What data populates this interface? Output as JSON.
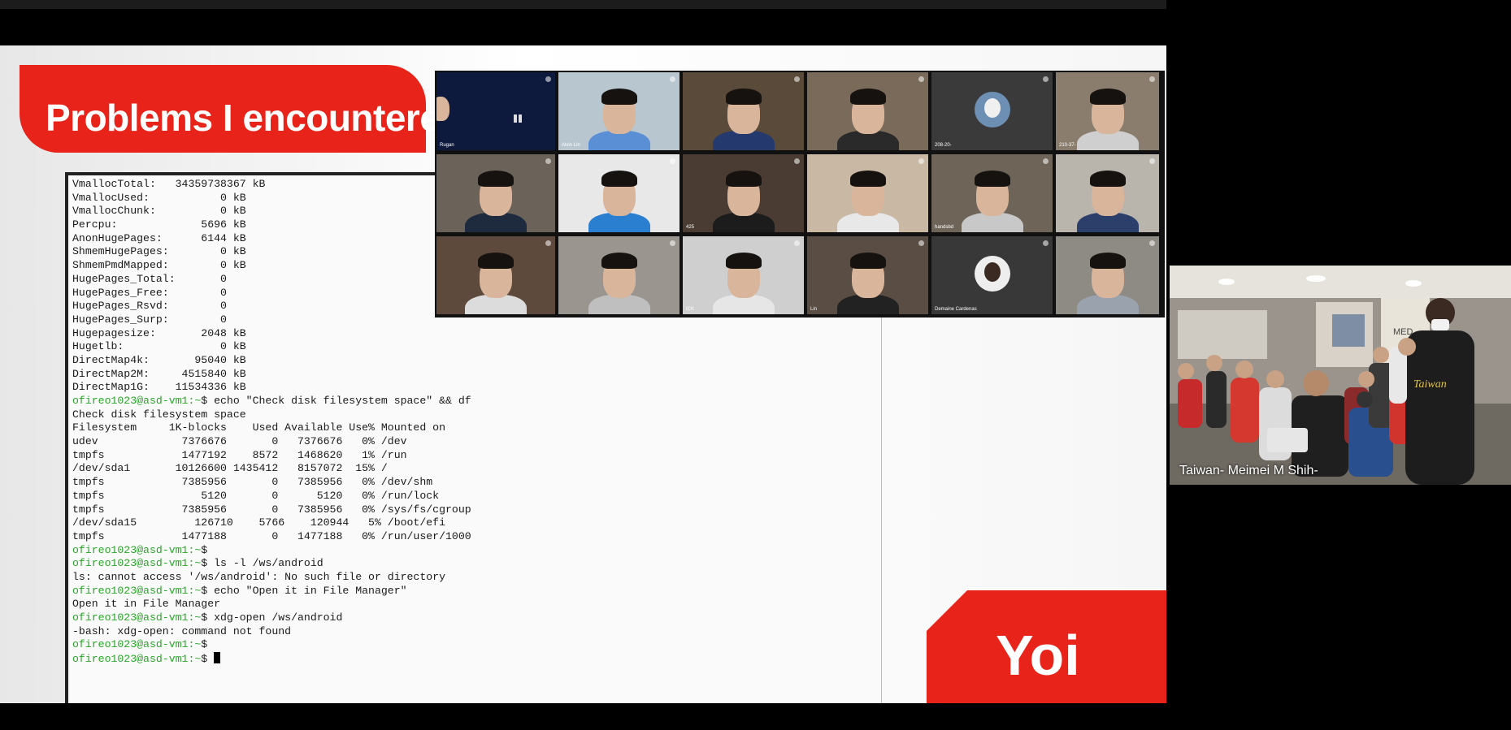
{
  "slide": {
    "title": "Problems I encountered",
    "badge": "Yoi"
  },
  "terminal": {
    "lines": [
      {
        "text": "VmallocTotal:   34359738367 kB",
        "prompt": false
      },
      {
        "text": "VmallocUsed:           0 kB",
        "prompt": false
      },
      {
        "text": "VmallocChunk:          0 kB",
        "prompt": false
      },
      {
        "text": "Percpu:             5696 kB",
        "prompt": false
      },
      {
        "text": "AnonHugePages:      6144 kB",
        "prompt": false
      },
      {
        "text": "ShmemHugePages:        0 kB",
        "prompt": false
      },
      {
        "text": "ShmemPmdMapped:        0 kB",
        "prompt": false
      },
      {
        "text": "HugePages_Total:       0",
        "prompt": false
      },
      {
        "text": "HugePages_Free:        0",
        "prompt": false
      },
      {
        "text": "HugePages_Rsvd:        0",
        "prompt": false
      },
      {
        "text": "HugePages_Surp:        0",
        "prompt": false
      },
      {
        "text": "Hugepagesize:       2048 kB",
        "prompt": false
      },
      {
        "text": "Hugetlb:               0 kB",
        "prompt": false
      },
      {
        "text": "DirectMap4k:       95040 kB",
        "prompt": false
      },
      {
        "text": "DirectMap2M:     4515840 kB",
        "prompt": false
      },
      {
        "text": "DirectMap1G:    11534336 kB",
        "prompt": false
      },
      {
        "text": "ofireo1023@asd-vm1:~$ echo \"Check disk filesystem space\" && df",
        "prompt": true
      },
      {
        "text": "Check disk filesystem space",
        "prompt": false
      },
      {
        "text": "Filesystem     1K-blocks    Used Available Use% Mounted on",
        "prompt": false
      },
      {
        "text": "udev             7376676       0   7376676   0% /dev",
        "prompt": false
      },
      {
        "text": "tmpfs            1477192    8572   1468620   1% /run",
        "prompt": false
      },
      {
        "text": "/dev/sda1       10126600 1435412   8157072  15% /",
        "prompt": false
      },
      {
        "text": "tmpfs            7385956       0   7385956   0% /dev/shm",
        "prompt": false
      },
      {
        "text": "tmpfs               5120       0      5120   0% /run/lock",
        "prompt": false
      },
      {
        "text": "tmpfs            7385956       0   7385956   0% /sys/fs/cgroup",
        "prompt": false
      },
      {
        "text": "/dev/sda15         126710    5766    120944   5% /boot/efi",
        "prompt": false
      },
      {
        "text": "tmpfs            1477188       0   1477188   0% /run/user/1000",
        "prompt": false
      },
      {
        "text": "ofireo1023@asd-vm1:~$",
        "prompt": true
      },
      {
        "text": "ofireo1023@asd-vm1:~$ ls -l /ws/android",
        "prompt": true
      },
      {
        "text": "ls: cannot access '/ws/android': No such file or directory",
        "prompt": false
      },
      {
        "text": "ofireo1023@asd-vm1:~$ echo \"Open it in File Manager\"",
        "prompt": true
      },
      {
        "text": "Open it in File Manager",
        "prompt": false
      },
      {
        "text": "ofireo1023@asd-vm1:~$ xdg-open /ws/android",
        "prompt": true
      },
      {
        "text": "-bash: xdg-open: command not found",
        "prompt": false
      },
      {
        "text": "ofireo1023@asd-vm1:~$",
        "prompt": true
      },
      {
        "text": "ofireo1023@asd-vm1:~$ ",
        "prompt": true
      }
    ]
  },
  "participants": [
    {
      "name": "Rugan"
    },
    {
      "name": "Alvin Lin"
    },
    {
      "name": ""
    },
    {
      "name": ""
    },
    {
      "name": "208-20-"
    },
    {
      "name": "210-37-"
    },
    {
      "name": ""
    },
    {
      "name": ""
    },
    {
      "name": "425"
    },
    {
      "name": ""
    },
    {
      "name": "handsbd"
    },
    {
      "name": ""
    },
    {
      "name": ""
    },
    {
      "name": ""
    },
    {
      "name": "ICK"
    },
    {
      "name": "Lin"
    },
    {
      "name": "Demaine Cardenas"
    },
    {
      "name": ""
    }
  ],
  "side_video": {
    "caption": "Taiwan- Meimei M Shih-"
  },
  "colors": {
    "accent_red": "#e8231a",
    "prompt_green": "#2aa52a"
  }
}
